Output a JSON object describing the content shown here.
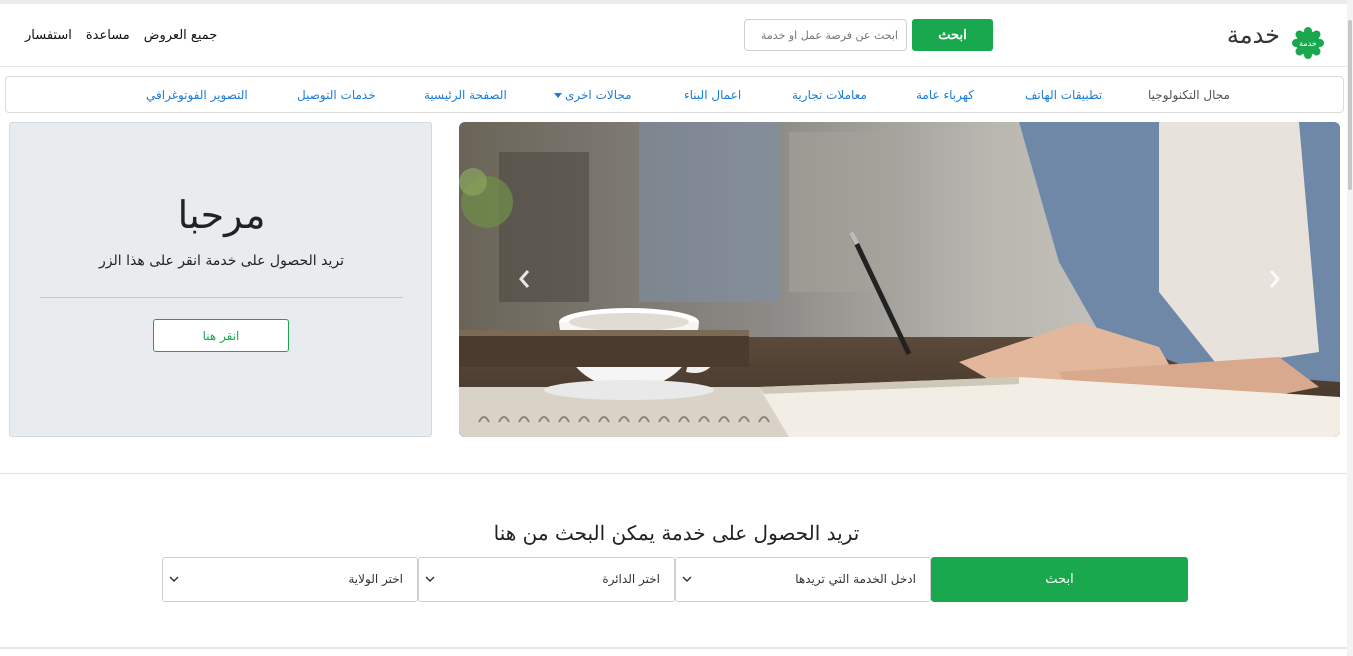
{
  "header": {
    "logo_badge_text": "خدمة",
    "logo_text": "خدمة",
    "search_button": "ابحث",
    "search_placeholder": "ابحث عن فرصة عمل او خدمة",
    "links": [
      "جميع العروض",
      "مساعدة",
      "استفسار"
    ]
  },
  "nav": {
    "items": [
      "مجال التكنولوجيا",
      "تطبيقات الهاتف",
      "كهرباء عامة",
      "معاملات تجارية",
      "اعمال البناء",
      "مجالات اخرى",
      "الصفحة الرئيسية",
      "خدمات التوصيل",
      "التصوير الفوتوغرافي"
    ]
  },
  "welcome": {
    "title": "مرحبا",
    "subtitle": "تريد الحصول على خدمة انقر على هذا الزر",
    "button": "انقر هنا"
  },
  "search_section": {
    "title": "تريد الحصول على خدمة يمكن البحث من هنا",
    "service_select": "ادخل الخدمة التي تريدها",
    "district_select": "اختر الدائرة",
    "state_select": "اختر الولاية",
    "button": "ابحث"
  },
  "colors": {
    "accent": "#1aa84f",
    "link": "#1c7dd6"
  }
}
